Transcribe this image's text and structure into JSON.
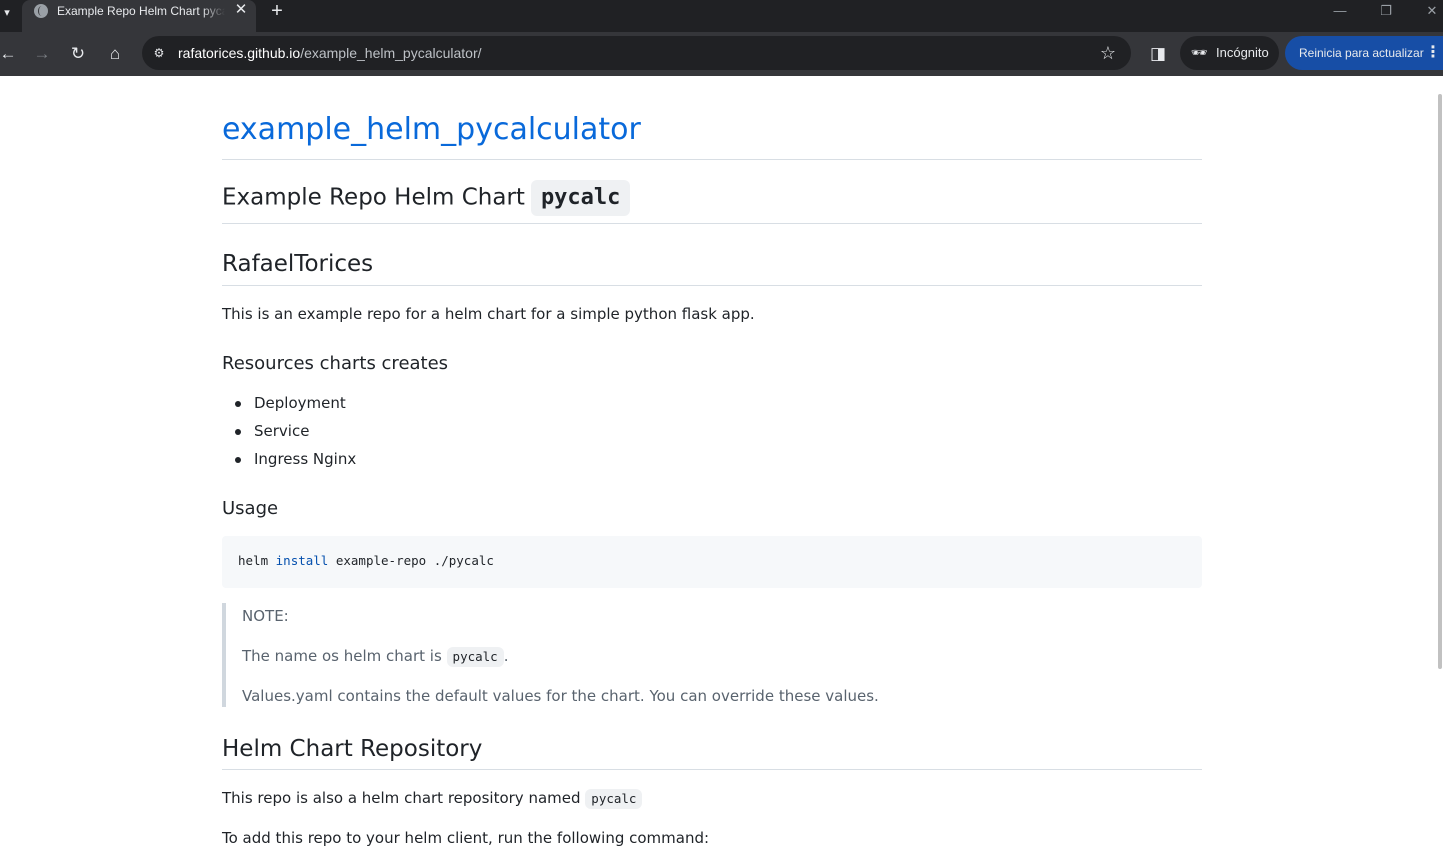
{
  "browser": {
    "tab_title": "Example Repo Helm Chart pycalc",
    "tab_close": "✕",
    "new_tab": "+",
    "url_host": "rafatorices.github.io",
    "url_path": "/example_helm_pycalculator/",
    "incognito_label": "Incógnito",
    "update_label": "Reinicia para actualizar",
    "icons": {
      "tab_list": "chevron-down-icon",
      "back": "back-arrow-icon",
      "forward": "forward-arrow-icon",
      "reload": "reload-icon",
      "home": "home-icon",
      "site_info": "site-info-icon",
      "bookmark": "star-icon",
      "side_panel": "side-panel-icon",
      "incognito": "incognito-icon",
      "menu": "more-vertical-icon",
      "minimize": "minimize-icon",
      "restore": "restore-icon",
      "close": "close-window-icon"
    }
  },
  "page": {
    "site_title": "example_helm_pycalculator",
    "heading1_text": "Example Repo Helm Chart",
    "heading1_code": "pycalc",
    "author_heading": "RafaelTorices",
    "intro": "This is an example repo for a helm chart for a simple python flask app.",
    "resources_heading": "Resources charts creates",
    "resources": [
      "Deployment",
      "Service",
      "Ingress Nginx"
    ],
    "usage_heading": "Usage",
    "usage_code": {
      "cmd": "helm",
      "keyword": "install",
      "args": "example-repo ./pycalc"
    },
    "note": {
      "title": "NOTE:",
      "line1_before": "The name os helm chart is",
      "line1_code": "pycalc",
      "line1_after": ".",
      "line2": "Values.yaml contains the default values for the chart. You can override these values."
    },
    "repo_heading": "Helm Chart Repository",
    "repo_line_before": "This repo is also a helm chart repository named",
    "repo_line_code": "pycalc",
    "add_repo_line": "To add this repo to your helm client, run the following command:"
  },
  "colors": {
    "link": "#0969da",
    "text": "#1f2328",
    "muted": "#59636e",
    "code_bg": "#f6f8fa",
    "chrome_dark": "#202124",
    "chrome_toolbar": "#35363a",
    "update_button": "#174ea6"
  }
}
